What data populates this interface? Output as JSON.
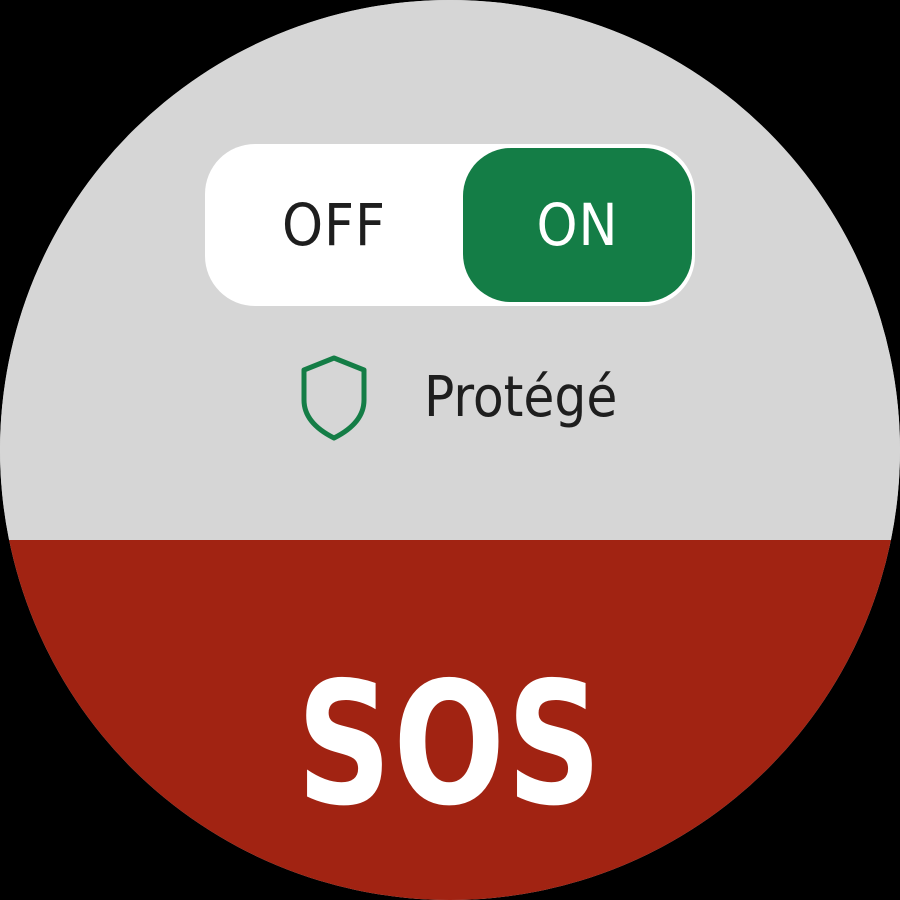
{
  "theme": {
    "background": "#000000",
    "panel_bg": "#d6d6d6",
    "toggle_bg": "#ffffff",
    "accent_green": "#147d46",
    "sos_red": "#a12312",
    "text_dark": "#1e1e1e",
    "text_light": "#ffffff"
  },
  "protection_toggle": {
    "off_label": "OFF",
    "on_label": "ON",
    "state": "ON"
  },
  "status": {
    "icon": "shield-icon",
    "label": "Protégé"
  },
  "sos": {
    "label": "SOS"
  }
}
